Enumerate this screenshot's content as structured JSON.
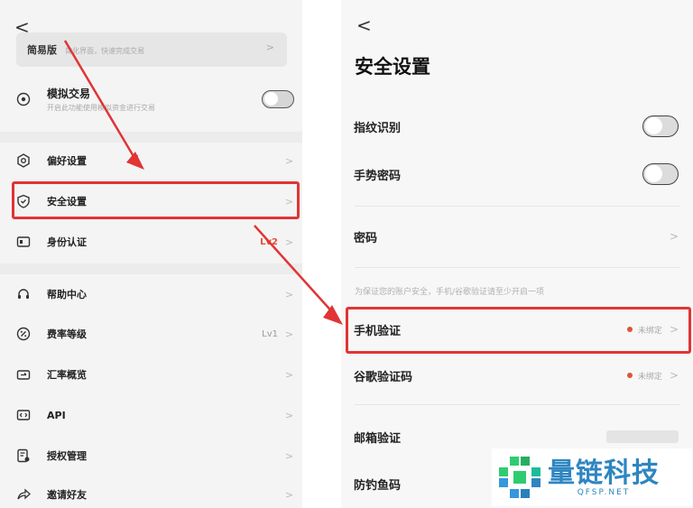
{
  "left": {
    "back": "<",
    "banner": {
      "title": "简易版",
      "subtitle": "简化界面，快速完成交易",
      "arrow": ">"
    },
    "sim_trading": {
      "label": "模拟交易",
      "sub": "开启此功能使用模拟资金进行交易",
      "toggle_on": false
    },
    "items": [
      {
        "icon": "gear-icon",
        "label": "偏好设置",
        "value": ""
      },
      {
        "icon": "shield-icon",
        "label": "安全设置",
        "value": ""
      },
      {
        "icon": "id-card-icon",
        "label": "身份认证",
        "value": "Lv2"
      },
      {
        "icon": "headset-icon",
        "label": "帮助中心",
        "value": ""
      },
      {
        "icon": "percent-icon",
        "label": "费率等级",
        "value": "Lv1"
      },
      {
        "icon": "exchange-icon",
        "label": "汇率概览",
        "value": ""
      },
      {
        "icon": "api-icon",
        "label": "API",
        "value": ""
      },
      {
        "icon": "license-icon",
        "label": "授权管理",
        "value": ""
      },
      {
        "icon": "share-icon",
        "label": "邀请好友",
        "value": ""
      }
    ],
    "chevron": ">"
  },
  "right": {
    "back": "<",
    "title": "安全设置",
    "fingerprint": {
      "label": "指纹识别",
      "toggle_on": false
    },
    "gesture": {
      "label": "手势密码",
      "toggle_on": false
    },
    "password": {
      "label": "密码"
    },
    "hint": "为保证您的账户安全，手机/谷歌验证请至少开启一项",
    "phone": {
      "label": "手机验证",
      "status": "未绑定"
    },
    "google": {
      "label": "谷歌验证码",
      "status": "未绑定"
    },
    "email": {
      "label": "邮箱验证"
    },
    "anti_phishing": {
      "label": "防钓鱼码"
    },
    "chevron": ">"
  },
  "logo": {
    "name": "量链科技",
    "domain": "QFSP.NET"
  },
  "colors": {
    "highlight": "#e13434",
    "arrow": "#e13434",
    "brand": "#2e86c1",
    "status_dot": "#e0533b"
  }
}
